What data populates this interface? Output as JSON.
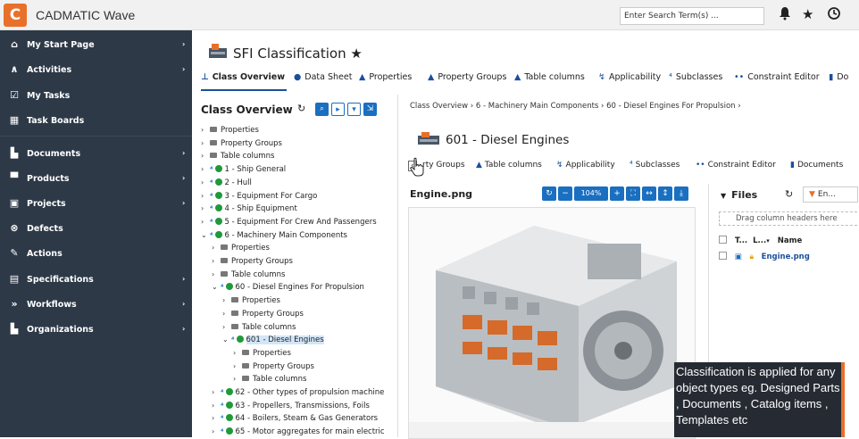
{
  "app": {
    "title": "CADMATIC Wave",
    "logo": "c-logo"
  },
  "topbar": {
    "search_placeholder": "Enter Search Term(s) ...",
    "icons": [
      "bell-icon",
      "star-icon",
      "history-icon"
    ]
  },
  "sidebar": {
    "items": [
      {
        "label": "My Start Page",
        "icon": "home-icon",
        "arrow": "›"
      },
      {
        "label": "Activities",
        "icon": "activity-icon",
        "arrow": "›"
      },
      {
        "label": "My Tasks",
        "icon": "task-check-icon",
        "arrow": ""
      },
      {
        "label": "Task Boards",
        "icon": "board-icon",
        "arrow": ""
      },
      {
        "label": "Documents",
        "icon": "document-icon",
        "arrow": "›"
      },
      {
        "label": "Products",
        "icon": "product-icon",
        "arrow": "›"
      },
      {
        "label": "Projects",
        "icon": "project-icon",
        "arrow": "›"
      },
      {
        "label": "Defects",
        "icon": "defect-icon",
        "arrow": ""
      },
      {
        "label": "Actions",
        "icon": "wrench-icon",
        "arrow": ""
      },
      {
        "label": "Specifications",
        "icon": "spec-icon",
        "arrow": "›"
      },
      {
        "label": "Workflows",
        "icon": "workflow-icon",
        "arrow": "›"
      },
      {
        "label": "Organizations",
        "icon": "organization-icon",
        "arrow": "›"
      }
    ]
  },
  "header": {
    "title": "SFI Classification ★"
  },
  "tabs": [
    {
      "label": "Class Overview",
      "icon": "⊥"
    },
    {
      "label": "Data Sheet",
      "icon": "●"
    },
    {
      "label": "Properties",
      "icon": "▲"
    },
    {
      "label": "Property Groups",
      "icon": "▲"
    },
    {
      "label": "Table columns",
      "icon": "▲"
    },
    {
      "label": "Applicability",
      "icon": "↯"
    },
    {
      "label": "Subclasses",
      "icon": "⁴"
    },
    {
      "label": "Constraint Editor",
      "icon": "••"
    },
    {
      "label": "Do",
      "icon": "▮"
    }
  ],
  "tree": {
    "title": "Class Overview",
    "rows": [
      {
        "caret": "›",
        "kind": "folder",
        "label": "Properties"
      },
      {
        "caret": "›",
        "kind": "folder",
        "label": "Property Groups"
      },
      {
        "caret": "›",
        "kind": "folder",
        "label": "Table columns"
      },
      {
        "caret": "›",
        "kind": "class",
        "label": "1 - Ship General"
      },
      {
        "caret": "›",
        "kind": "class",
        "label": "2 - Hull"
      },
      {
        "caret": "›",
        "kind": "class",
        "label": "3 - Equipment For Cargo"
      },
      {
        "caret": "›",
        "kind": "class",
        "label": "4 - Ship Equipment"
      },
      {
        "caret": "›",
        "kind": "class",
        "label": "5 - Equipment For Crew And Passengers"
      },
      {
        "caret": "⌄",
        "kind": "class",
        "label": "6 - Machinery Main Components"
      },
      {
        "caret": "›",
        "kind": "folder",
        "label": "Properties"
      },
      {
        "caret": "›",
        "kind": "folder",
        "label": "Property Groups"
      },
      {
        "caret": "›",
        "kind": "folder",
        "label": "Table columns"
      },
      {
        "caret": "⌄",
        "kind": "class",
        "label": "60 - Diesel Engines For Propulsion"
      },
      {
        "caret": "›",
        "kind": "folder",
        "label": "Properties"
      },
      {
        "caret": "›",
        "kind": "folder",
        "label": "Property Groups"
      },
      {
        "caret": "›",
        "kind": "folder",
        "label": "Table columns"
      },
      {
        "caret": "⌄",
        "kind": "class",
        "label": "601 - Diesel Engines"
      },
      {
        "caret": "›",
        "kind": "folder",
        "label": "Properties"
      },
      {
        "caret": "›",
        "kind": "folder",
        "label": "Property Groups"
      },
      {
        "caret": "›",
        "kind": "folder",
        "label": "Table columns"
      },
      {
        "caret": "›",
        "kind": "class",
        "label": "62 - Other types of propulsion machine"
      },
      {
        "caret": "›",
        "kind": "class",
        "label": "63 - Propellers, Transmissions, Foils"
      },
      {
        "caret": "›",
        "kind": "class",
        "label": "64 - Boilers, Steam & Gas Generators"
      },
      {
        "caret": "›",
        "kind": "class",
        "label": "65 - Motor aggregates for main electric"
      }
    ]
  },
  "breadcrumb": "Class Overview › 6 - Machinery Main Components › 60 - Diesel Engines For Propulsion ›",
  "subheader": {
    "title": "601 - Diesel Engines"
  },
  "subtabs": [
    {
      "label": "rty Groups",
      "icon": "▲"
    },
    {
      "label": "Table columns",
      "icon": "▲"
    },
    {
      "label": "Applicability",
      "icon": "↯"
    },
    {
      "label": "Subclasses",
      "icon": "⁴"
    },
    {
      "label": "Constraint Editor",
      "icon": "••"
    },
    {
      "label": "Documents",
      "icon": "▮"
    }
  ],
  "viewer": {
    "filename": "Engine.png",
    "zoom": "104%"
  },
  "files": {
    "title": "Files",
    "search_placeholder": "En...",
    "drag_hint": "Drag column headers here",
    "columns": [
      "T...",
      "L...",
      "Name"
    ],
    "rows": [
      {
        "name": "Engine.png"
      }
    ]
  },
  "caption": "Classification is applied for any object types eg. Designed Parts , Documents , Catalog items , Templates etc",
  "colors": {
    "accent": "#1a6fc0",
    "sidebar": "#2d3947",
    "brand": "#e8702a"
  }
}
